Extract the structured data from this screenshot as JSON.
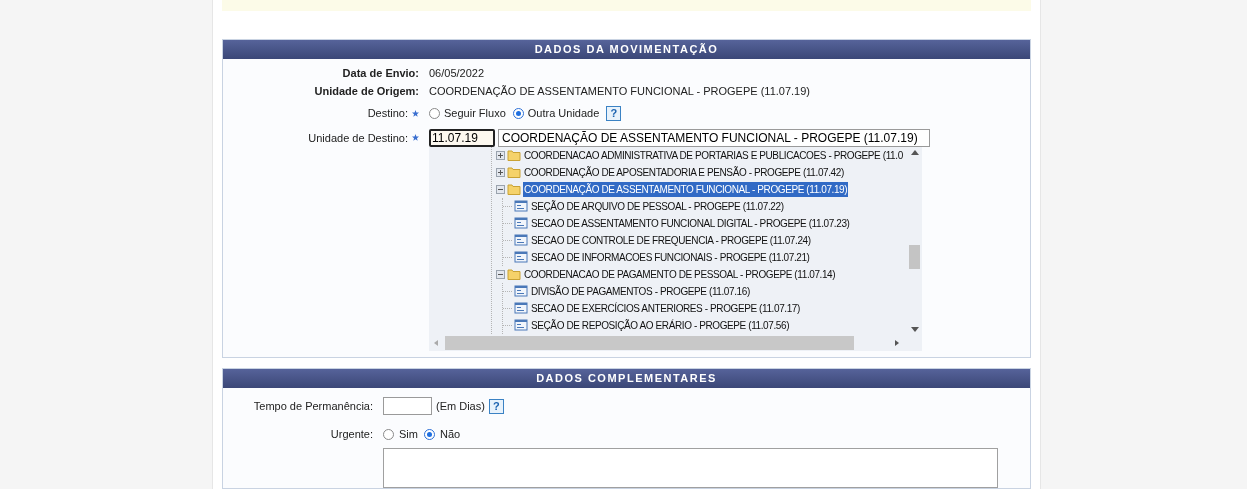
{
  "movimentacao": {
    "title": "DADOS DA MOVIMENTAÇÃO",
    "fields": [
      {
        "label": "Data de Envio:",
        "value": "06/05/2022"
      },
      {
        "label": "Unidade de Origem:",
        "value": "COORDENAÇÃO DE ASSENTAMENTO FUNCIONAL - PROGEPE (11.07.19)"
      }
    ],
    "destino": {
      "label": "Destino:",
      "required": true,
      "options": [
        {
          "label": "Seguir Fluxo",
          "selected": false
        },
        {
          "label": "Outra Unidade",
          "selected": true
        }
      ],
      "help": "?"
    },
    "unidade_destino": {
      "label": "Unidade de Destino:",
      "required": true,
      "code": "11.07.19",
      "name": "COORDENAÇÃO DE ASSENTAMENTO FUNCIONAL - PROGEPE (11.07.19)"
    },
    "tree": [
      {
        "kind": "folder",
        "label": "COORDENACAO ADMINISTRATIVA DE PORTARIAS E PUBLICACOES - PROGEPE (11.0",
        "expanded": false,
        "selected": false
      },
      {
        "kind": "folder",
        "label": "COORDENAÇÃO DE APOSENTADORIA E PENSÃO - PROGEPE (11.07.42)",
        "expanded": false,
        "selected": false
      },
      {
        "kind": "folder",
        "label": "COORDENAÇÃO DE ASSENTAMENTO FUNCIONAL - PROGEPE (11.07.19)",
        "expanded": true,
        "selected": true,
        "children": [
          {
            "kind": "unit",
            "label": "SEÇÃO DE ARQUIVO DE PESSOAL - PROGEPE (11.07.22)",
            "selected": false
          },
          {
            "kind": "unit",
            "label": "SECAO DE ASSENTAMENTO FUNCIONAL DIGITAL - PROGEPE (11.07.23)",
            "selected": false
          },
          {
            "kind": "unit",
            "label": "SECAO DE CONTROLE DE FREQUENCIA - PROGEPE (11.07.24)",
            "selected": false
          },
          {
            "kind": "unit",
            "label": "SECAO DE INFORMACOES FUNCIONAIS - PROGEPE (11.07.21)",
            "selected": false
          }
        ]
      },
      {
        "kind": "folder",
        "label": "COORDENACAO DE PAGAMENTO DE PESSOAL - PROGEPE (11.07.14)",
        "expanded": true,
        "selected": false,
        "children": [
          {
            "kind": "unit",
            "label": "DIVISÃO DE PAGAMENTOS - PROGEPE (11.07.16)",
            "selected": false
          },
          {
            "kind": "unit",
            "label": "SECAO DE EXERCÍCIOS ANTERIORES - PROGEPE (11.07.17)",
            "selected": false
          },
          {
            "kind": "unit",
            "label": "SEÇÃO DE REPOSIÇÃO AO ERÁRIO - PROGEPE (11.07.56)",
            "selected": false
          }
        ]
      }
    ]
  },
  "complementares": {
    "title": "DADOS COMPLEMENTARES",
    "tempo": {
      "label": "Tempo de Permanência:",
      "unit": "(Em Dias)",
      "help": "?"
    },
    "urgente": {
      "label": "Urgente:",
      "options": [
        {
          "label": "Sim",
          "selected": false
        },
        {
          "label": "Não",
          "selected": true
        }
      ]
    }
  }
}
